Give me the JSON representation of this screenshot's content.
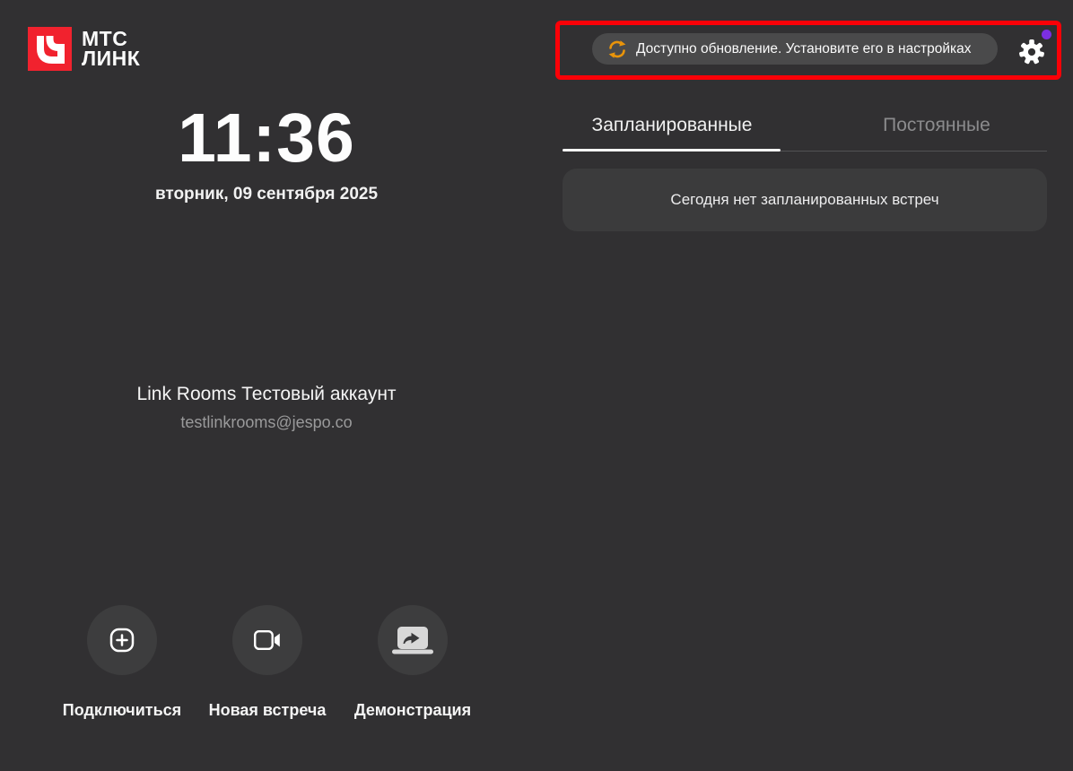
{
  "app": {
    "brand_line1": "МТС",
    "brand_line2": "ЛИНК",
    "logo_icon": "mts-link-logo",
    "brand_red": "#f1222e",
    "background_color": "#313032"
  },
  "header": {
    "update_notice": "Доступно обновление. Установите его в настройках",
    "update_icon": "sync-icon",
    "update_icon_color": "#e9940a",
    "settings_icon": "gear-icon",
    "settings_badge_icon": "notification-dot",
    "settings_badge_color": "#7c2fe2",
    "annotation_color": "#fb0007"
  },
  "clock": {
    "time": "11:36",
    "date": "вторник, 09 сентября 2025"
  },
  "account": {
    "name": "Link Rooms Тестовый аккаунт",
    "email": "testlinkrooms@jespo.co"
  },
  "tabs": [
    {
      "label": "Запланированные",
      "active": true
    },
    {
      "label": "Постоянные",
      "active": false
    }
  ],
  "meetings": {
    "empty_message": "Сегодня нет запланированных встреч"
  },
  "actions": [
    {
      "label": "Подключиться",
      "icon": "plus-square-icon"
    },
    {
      "label": "Новая встреча",
      "icon": "video-camera-icon"
    },
    {
      "label": "Демонстрация",
      "icon": "screen-share-icon"
    }
  ]
}
